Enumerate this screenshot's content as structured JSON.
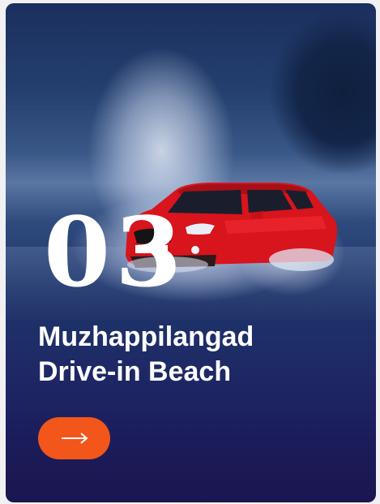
{
  "card": {
    "number": "03",
    "title_line1": "Muzhappilangad",
    "title_line2": "Drive-in Beach",
    "image_alt": "Red car splashing through water on beach"
  },
  "button": {
    "icon": "arrow-right-icon",
    "color": "#f2561a"
  }
}
